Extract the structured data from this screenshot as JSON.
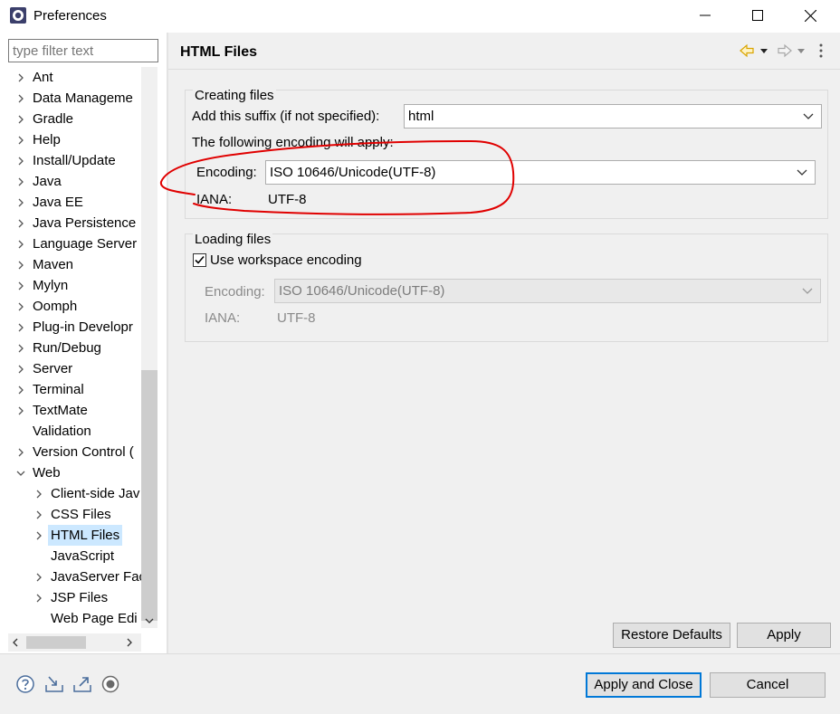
{
  "window": {
    "title": "Preferences",
    "minimize_icon": "minimize-icon",
    "maximize_icon": "maximize-icon",
    "close_icon": "close-icon"
  },
  "filter": {
    "placeholder": "type filter text",
    "value": ""
  },
  "tree": {
    "items": [
      {
        "label": "Ant",
        "expandable": true,
        "expanded": false
      },
      {
        "label": "Data Manageme",
        "expandable": true,
        "expanded": false
      },
      {
        "label": "Gradle",
        "expandable": true,
        "expanded": false
      },
      {
        "label": "Help",
        "expandable": true,
        "expanded": false
      },
      {
        "label": "Install/Update",
        "expandable": true,
        "expanded": false
      },
      {
        "label": "Java",
        "expandable": true,
        "expanded": false
      },
      {
        "label": "Java EE",
        "expandable": true,
        "expanded": false
      },
      {
        "label": "Java Persistence",
        "expandable": true,
        "expanded": false
      },
      {
        "label": "Language Server",
        "expandable": true,
        "expanded": false
      },
      {
        "label": "Maven",
        "expandable": true,
        "expanded": false
      },
      {
        "label": "Mylyn",
        "expandable": true,
        "expanded": false
      },
      {
        "label": "Oomph",
        "expandable": true,
        "expanded": false
      },
      {
        "label": "Plug-in Developr",
        "expandable": true,
        "expanded": false
      },
      {
        "label": "Run/Debug",
        "expandable": true,
        "expanded": false
      },
      {
        "label": "Server",
        "expandable": true,
        "expanded": false
      },
      {
        "label": "Terminal",
        "expandable": true,
        "expanded": false
      },
      {
        "label": "TextMate",
        "expandable": true,
        "expanded": false
      },
      {
        "label": "Validation",
        "expandable": false,
        "expanded": false
      },
      {
        "label": "Version Control (",
        "expandable": true,
        "expanded": false
      },
      {
        "label": "Web",
        "expandable": true,
        "expanded": true
      },
      {
        "label": "Client-side Jav",
        "expandable": true,
        "expanded": false,
        "child": true
      },
      {
        "label": "CSS Files",
        "expandable": true,
        "expanded": false,
        "child": true
      },
      {
        "label": "HTML Files",
        "expandable": true,
        "expanded": false,
        "child": true,
        "selected": true
      },
      {
        "label": "JavaScript",
        "expandable": false,
        "expanded": false,
        "child": true
      },
      {
        "label": "JavaServer Fac",
        "expandable": true,
        "expanded": false,
        "child": true
      },
      {
        "label": "JSP Files",
        "expandable": true,
        "expanded": false,
        "child": true
      },
      {
        "label": "Web Page Edi",
        "expandable": false,
        "expanded": false,
        "child": true
      }
    ]
  },
  "page": {
    "title": "HTML Files",
    "nav": {
      "back_icon": "back-arrow-icon",
      "forward_icon": "forward-arrow-icon",
      "menu_icon": "view-menu-icon"
    }
  },
  "creating": {
    "group_title": "Creating files",
    "suffix_label": "Add this suffix (if not specified):",
    "suffix_value": "html",
    "encoding_note": "The following encoding will apply:",
    "encoding_label": "Encoding:",
    "encoding_value": "ISO 10646/Unicode(UTF-8)",
    "iana_label": "IANA:",
    "iana_value": "UTF-8"
  },
  "loading": {
    "group_title": "Loading files",
    "workspace_checkbox_label": "Use workspace encoding",
    "workspace_checked": true,
    "encoding_label": "Encoding:",
    "encoding_value": "ISO 10646/Unicode(UTF-8)",
    "iana_label": "IANA:",
    "iana_value": "UTF-8"
  },
  "buttons": {
    "restore_defaults": "Restore Defaults",
    "apply": "Apply",
    "apply_and_close": "Apply and Close",
    "cancel": "Cancel"
  },
  "bottom_icons": [
    "help-icon",
    "import-icon",
    "export-icon",
    "record-icon"
  ],
  "colors": {
    "selection": "#cce8ff",
    "default_button_border": "#0078d7",
    "annotation_stroke": "#e00000",
    "panel_bg": "#f0f0f0"
  }
}
